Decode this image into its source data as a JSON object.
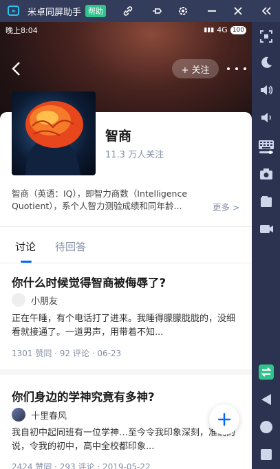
{
  "window": {
    "title": "米卓同屏助手",
    "help_label": "帮助",
    "icons": [
      "link-icon",
      "pin-icon",
      "settings-icon",
      "minimize-icon",
      "close-icon",
      "collapse-icon"
    ]
  },
  "status_bar": {
    "time": "晚上8:04",
    "network": "4G",
    "battery": "100"
  },
  "header": {
    "follow_label": "+ 关注"
  },
  "topic": {
    "title": "智商",
    "followers": "11.3 万人关注",
    "description": "智商（英语：IQ），即智力商数（Intelligence Quotient），系个人智力测验成绩和同年龄...",
    "more_label": "更多 >"
  },
  "tabs": [
    {
      "label": "讨论",
      "active": true
    },
    {
      "label": "待回答",
      "active": false
    }
  ],
  "posts": [
    {
      "question": "你什么时候觉得智商被侮辱了?",
      "author": "小朋友",
      "excerpt": "正在午睡，有个电话打了进来。我睡得朦朦胧胧的，没细看就接通了。一道男声，用带着不知...",
      "meta": "1301 赞同 · 92 评论 · 06-23"
    },
    {
      "question": "你们身边的学神究竟有多神?",
      "author": "十里春风",
      "excerpt": "我自初中起同班有一位学神…至今令我印象深刻，准确的说，令我的初中，高中全校都印象...",
      "meta": "2424 赞同 · 293 评论 · 2019-05-22"
    }
  ],
  "sidebar_icons": [
    "screenshot-icon",
    "night-mode-icon",
    "volume-up-icon",
    "volume-down-icon",
    "keyboard-icon",
    "camera-icon",
    "file-icon",
    "record-icon",
    "app-switch-icon",
    "back-nav-icon",
    "home-nav-icon",
    "recent-nav-icon"
  ],
  "colors": {
    "accent": "#0066ff",
    "help_badge": "#30c48d",
    "toolbar_bg": "#2b3350"
  }
}
